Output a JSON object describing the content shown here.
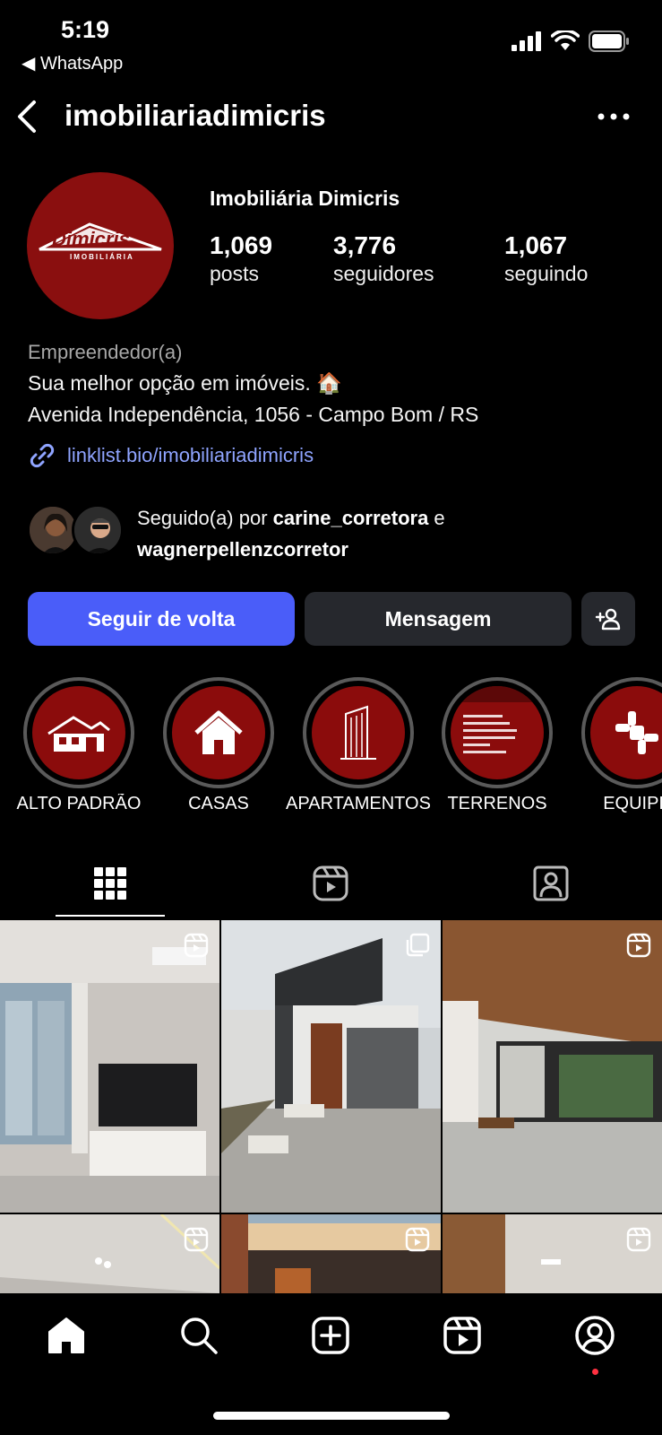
{
  "status_bar": {
    "time": "5:19",
    "back_app": "◀ WhatsApp"
  },
  "header": {
    "username": "imobiliariadimicris"
  },
  "profile": {
    "display_name": "Imobiliária Dimicris",
    "avatar_logo_text": "Dimicris",
    "avatar_logo_sub": "IMOBILIÁRIA",
    "stats": [
      {
        "value": "1,069",
        "label": "posts"
      },
      {
        "value": "3,776",
        "label": "seguidores"
      },
      {
        "value": "1,067",
        "label": "seguindo"
      }
    ],
    "category": "Empreendedor(a)",
    "bio_line1": "Sua melhor opção em imóveis. 🏠",
    "bio_line2": "Avenida Independência, 1056 - Campo Bom / RS",
    "link": "linklist.bio/imobiliariadimicris"
  },
  "followed_by": {
    "prefix": "Seguido(a) por ",
    "user1": "carine_corretora",
    "conj": " e",
    "user2": "wagnerpellenzcorretor"
  },
  "buttons": {
    "follow_back": "Seguir de volta",
    "message": "Mensagem"
  },
  "highlights": [
    {
      "label": "ALTO PADRÃO",
      "icon": "mansion-icon"
    },
    {
      "label": "CASAS",
      "icon": "house-icon"
    },
    {
      "label": "APARTAMENTOS",
      "icon": "building-icon"
    },
    {
      "label": "TERRENOS",
      "icon": "document-icon"
    },
    {
      "label": "EQUIPE",
      "icon": "team-hands-icon"
    }
  ],
  "colors": {
    "accent": "#4a5df9",
    "brand_red": "#8b0c0c",
    "link": "#8fa4ff",
    "notification_dot": "#ff3040"
  }
}
